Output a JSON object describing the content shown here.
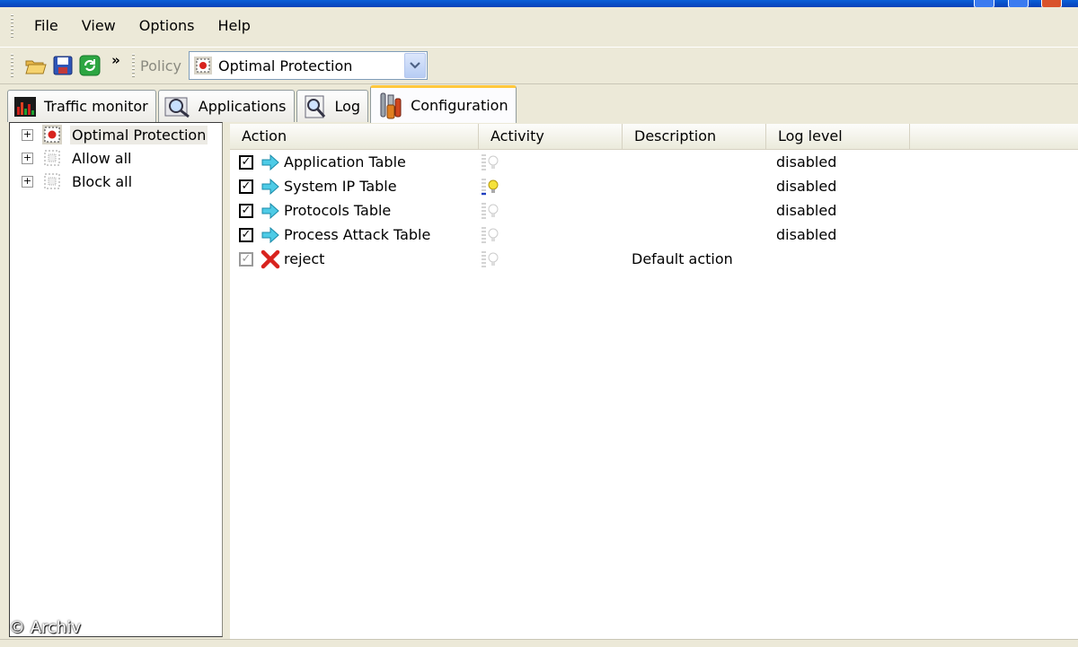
{
  "menu": {
    "items": [
      "File",
      "View",
      "Options",
      "Help"
    ]
  },
  "toolbar": {
    "open_icon": "folder-open-icon",
    "save_icon": "floppy-disk-icon",
    "refresh_icon": "refresh-icon",
    "overflow": "»",
    "policy_label": "Policy",
    "policy_value": "Optimal Protection"
  },
  "tabs": [
    {
      "label": "Traffic monitor",
      "icon": "bar-chart-icon"
    },
    {
      "label": "Applications",
      "icon": "magnifier-icon"
    },
    {
      "label": "Log",
      "icon": "log-magnifier-icon"
    },
    {
      "label": "Configuration",
      "icon": "tools-icon"
    }
  ],
  "tree": {
    "expander": "+",
    "items": [
      "Optimal Protection",
      "Allow all",
      "Block all"
    ]
  },
  "grid": {
    "columns": [
      "Action",
      "Activity",
      "Description",
      "Log level"
    ],
    "rows": [
      {
        "action": "Application Table",
        "description": "",
        "log_level": "disabled"
      },
      {
        "action": "System IP Table",
        "description": "",
        "log_level": "disabled"
      },
      {
        "action": "Protocols Table",
        "description": "",
        "log_level": "disabled"
      },
      {
        "action": "Process Attack Table",
        "description": "",
        "log_level": "disabled"
      },
      {
        "action": "reject",
        "description": "Default action",
        "log_level": ""
      }
    ]
  },
  "watermark": "© Archiv"
}
